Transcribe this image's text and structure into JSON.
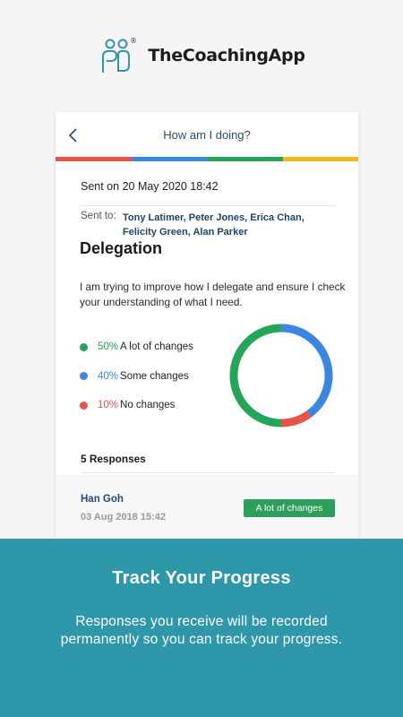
{
  "brand": {
    "name": "TheCoachingApp",
    "logo_icon": "people-logo-icon",
    "registered_mark": "®",
    "color": "#2e97aa"
  },
  "header": {
    "title": "How am I doing?",
    "back_icon": "chevron-left-icon",
    "color_bar": [
      "#e8534c",
      "#3b86e0",
      "#25a55a",
      "#f2b91f"
    ]
  },
  "message": {
    "sent_on": "Sent on 20 May 2020 18:42",
    "sent_to_label": "Sent to:",
    "recipients": "Tony Latimer, Peter Jones, Erica Chan, Felicity Green, Alan Parker",
    "topic": "Delegation",
    "description": "I am trying to improve how I delegate and ensure I check your understanding of what I need."
  },
  "results": {
    "legend": [
      {
        "pct": "50%",
        "label": "A lot of changes",
        "color": "#25a55a",
        "value": 50
      },
      {
        "pct": "40%",
        "label": "Some changes",
        "color": "#3b86e0",
        "value": 40
      },
      {
        "pct": "10%",
        "label": "No changes",
        "color": "#e8534c",
        "value": 10
      }
    ]
  },
  "chart_data": {
    "type": "pie",
    "categories": [
      "A lot of changes",
      "Some changes",
      "No changes"
    ],
    "values": [
      50,
      40,
      10
    ],
    "colors": [
      "#25a55a",
      "#3b86e0",
      "#e8534c"
    ]
  },
  "responses": {
    "title": "5 Responses",
    "items": [
      {
        "name": "Han Goh",
        "date": "03 Aug 2018 15:42",
        "badge": "A lot of changes",
        "badge_color": "#2e9e5b"
      }
    ]
  },
  "footer": {
    "title": "Track Your Progress",
    "line1": "Responses you receive will be recorded",
    "line2": "permanently so you can track your progress."
  }
}
